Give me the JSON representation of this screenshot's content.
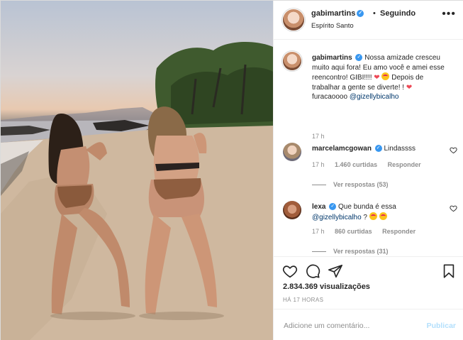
{
  "post": {
    "media_alt": "",
    "author": {
      "username": "gabimartins",
      "verified_icon": "verified-badge-icon"
    },
    "follow_dot": "•",
    "follow_label": "Seguindo",
    "location": "Espírito Santo",
    "more_icon": "more-options-icon"
  },
  "comments": [
    {
      "username": "gabimartins",
      "text_parts": [
        "Nossa amizade cresceu muito aqui fora! Eu amo você e amei esse reencontro! GIBI!!!! ",
        " ",
        " Depois de trabalhar a gente se diverte! ! ",
        " furacaoooo "
      ],
      "mention": "@gizellybicalho",
      "time": "17 h"
    },
    {
      "username": "marcelamcgowan",
      "text": "Lindassss",
      "time": "17 h",
      "likes": "1.460 curtidas",
      "reply": "Responder",
      "view_replies": "Ver respostas (53)"
    },
    {
      "username": "lexa",
      "text_prefix": "Que bunda é essa ",
      "mention": "@gizellybicalho",
      "text_suffix": " ? ",
      "time": "17 h",
      "likes": "860 curtidas",
      "reply": "Responder",
      "view_replies": "Ver respostas (31)"
    }
  ],
  "actions": {
    "views": "2.834.369 visualizações",
    "posted": "HÁ 17 HORAS",
    "comment_placeholder": "Adicione um comentário...",
    "publish_label": "Publicar"
  },
  "colors": {
    "accent": "#3897f0",
    "heart": "#ed4956",
    "mention": "#00376b",
    "muted": "#8e8e8e",
    "publish_disabled": "#b2dffc"
  }
}
